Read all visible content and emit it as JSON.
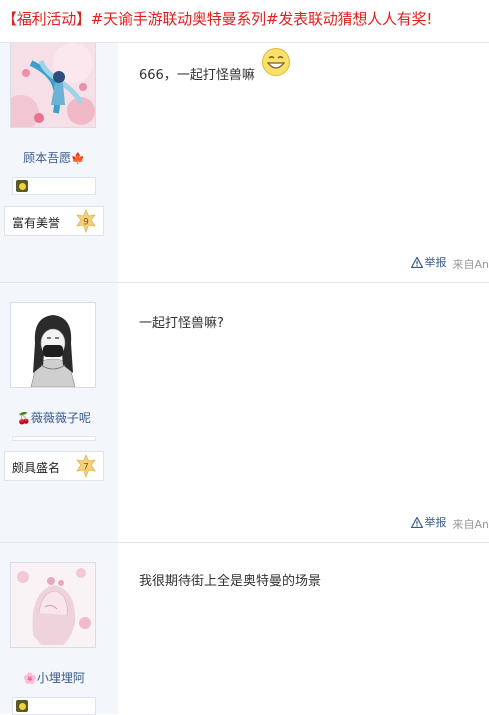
{
  "thread": {
    "title": "【福利活动】#天谕手游联动奥特曼系列#发表联动猜想人人有奖!"
  },
  "posts": [
    {
      "username": "顾本吾愿",
      "username_deco": "🍁",
      "honor_title": "富有美誉",
      "level": "9",
      "content": "666，一起打怪兽嘛",
      "report_label": "举报",
      "source_label": "来自An"
    },
    {
      "username": "薇薇薇子呢",
      "username_deco": "🍒",
      "honor_title": "颇具盛名",
      "level": "7",
      "content": "一起打怪兽嘛?",
      "report_label": "举报",
      "source_label": "来自An"
    },
    {
      "username": "小埋埋阿",
      "username_deco": "🌸",
      "content": "我很期待街上全是奥特曼的场景"
    }
  ],
  "colors": {
    "title_red": "#e02020",
    "link_blue": "#3a5a8c",
    "sidebar_bg": "#f3f6fb"
  },
  "icons": {
    "report": "warning-triangle-icon",
    "emoji": "grin-emoji-icon",
    "medal": "medal-icon",
    "level": "star-level-icon"
  }
}
